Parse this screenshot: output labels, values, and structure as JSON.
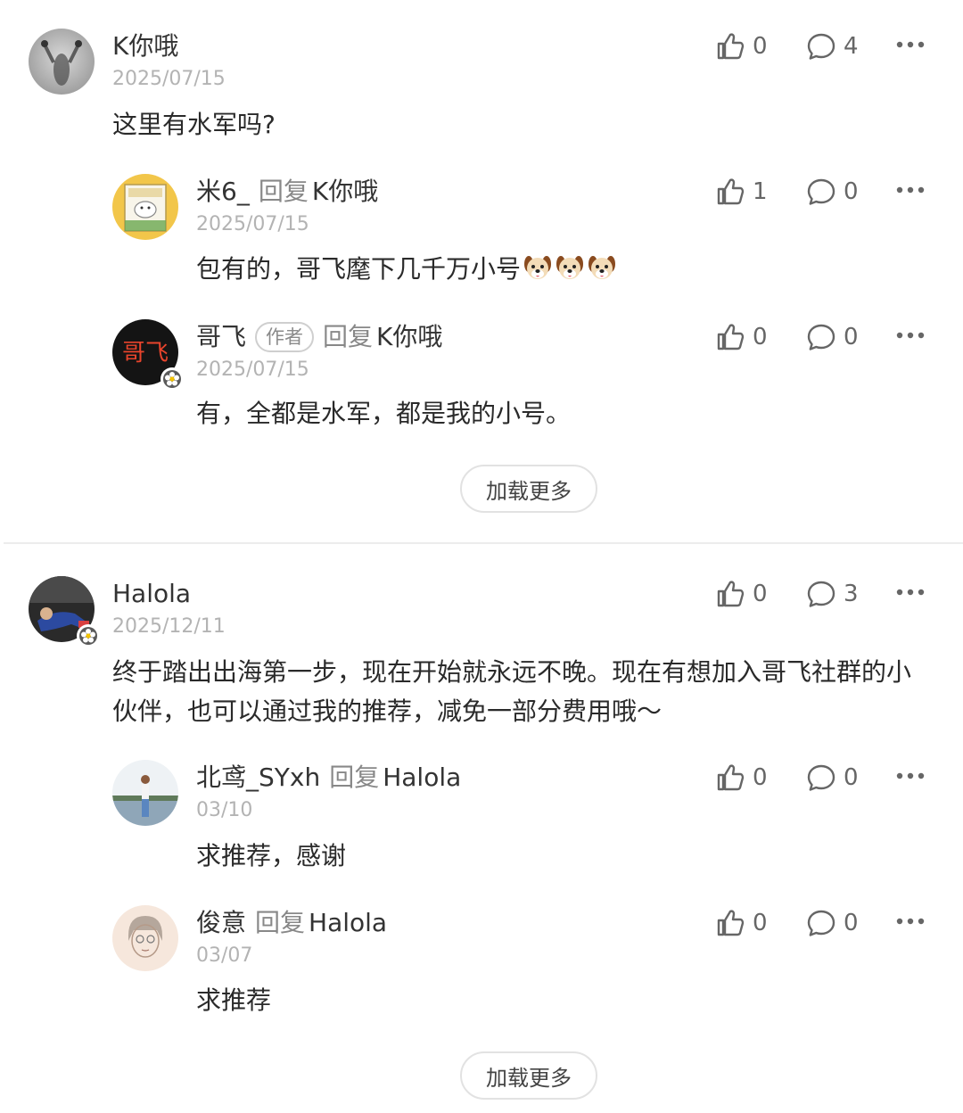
{
  "thread1": {
    "main": {
      "username": "K你哦",
      "date": "2025/07/15",
      "content": "这里有水军吗?",
      "likes": "0",
      "replies": "4"
    },
    "replies": [
      {
        "username": "米6_",
        "reply_word": "回复",
        "reply_target": "K你哦",
        "date": "2025/07/15",
        "content": "包有的，哥飞麾下几千万小号",
        "emoji": [
          "dog-face",
          "dog-face",
          "dog-face"
        ],
        "likes": "1",
        "replies": "0"
      },
      {
        "username": "哥飞",
        "author_tag": "作者",
        "reply_word": "回复",
        "reply_target": "K你哦",
        "date": "2025/07/15",
        "content": "有，全都是水军，都是我的小号。",
        "avatar_text": "哥飞",
        "likes": "0",
        "replies": "0"
      }
    ],
    "load_more": "加载更多"
  },
  "thread2": {
    "main": {
      "username": "Halola",
      "date": "2025/12/11",
      "content": "终于踏出出海第一步，现在开始就永远不晚。现在有想加入哥飞社群的小伙伴，也可以通过我的推荐，减免一部分费用哦～",
      "likes": "0",
      "replies": "3"
    },
    "replies": [
      {
        "username": "北鸢_SYxh",
        "reply_word": "回复",
        "reply_target": "Halola",
        "date": "03/10",
        "content": "求推荐，感谢",
        "likes": "0",
        "replies": "0"
      },
      {
        "username": "俊意",
        "reply_word": "回复",
        "reply_target": "Halola",
        "date": "03/07",
        "content": "求推荐",
        "likes": "0",
        "replies": "0"
      }
    ],
    "load_more": "加载更多"
  },
  "colors": {
    "text": "#333333",
    "muted": "#888888",
    "date": "#b3b3b3",
    "icon": "#666666",
    "divider": "#ececec"
  },
  "icons": {
    "like": "thumbs-up-icon",
    "comment": "comment-bubble-icon",
    "more": "more-dots-icon",
    "badge": "flower-badge-icon"
  }
}
